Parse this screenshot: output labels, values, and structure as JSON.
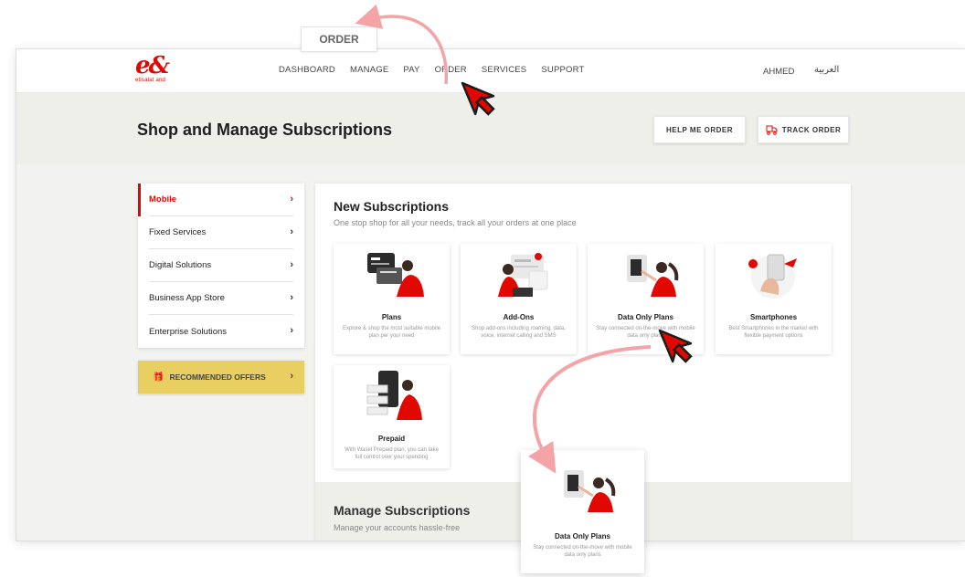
{
  "header": {
    "logo_mark": "e&",
    "logo_sub": "etisalat and",
    "nav": [
      "DASHBOARD",
      "MANAGE",
      "PAY",
      "ORDER",
      "SERVICES",
      "SUPPORT"
    ],
    "user": "AHMED",
    "lang": "العربية"
  },
  "hero": {
    "title": "Shop and Manage Subscriptions",
    "help_label": "HELP ME ORDER",
    "track_label": "TRACK ORDER"
  },
  "sidebar": {
    "items": [
      {
        "label": "Mobile"
      },
      {
        "label": "Fixed Services"
      },
      {
        "label": "Digital Solutions"
      },
      {
        "label": "Business App Store"
      },
      {
        "label": "Enterprise Solutions"
      }
    ],
    "offers_label": "RECOMMENDED OFFERS"
  },
  "main": {
    "title": "New Subscriptions",
    "subtitle": "One stop shop for all your needs, track all your orders at one place",
    "cards": [
      {
        "title": "Plans",
        "desc": "Explore & shop the most suitable mobile plan per your need"
      },
      {
        "title": "Add-Ons",
        "desc": "Shop add-ons including roaming, data, voice, internet calling and SMS"
      },
      {
        "title": "Data Only Plans",
        "desc": "Stay connected on-the-move with mobile data only plans"
      },
      {
        "title": "Smartphones",
        "desc": "Best Smartphones in the market with flexible payment options"
      },
      {
        "title": "Prepaid",
        "desc": "With Wasel Prepaid plan, you can take full control over your spending"
      }
    ],
    "manage_title": "Manage Subscriptions",
    "manage_subtitle": "Manage your accounts hassle-free"
  },
  "callouts": {
    "order_label": "ORDER",
    "zoom_title": "Data Only Plans",
    "zoom_desc": "Stay connected on-the-move with mobile data only plans"
  },
  "colors": {
    "brand": "#e00800",
    "offers": "#e9cf62",
    "arrow": "#f4a3a6"
  }
}
